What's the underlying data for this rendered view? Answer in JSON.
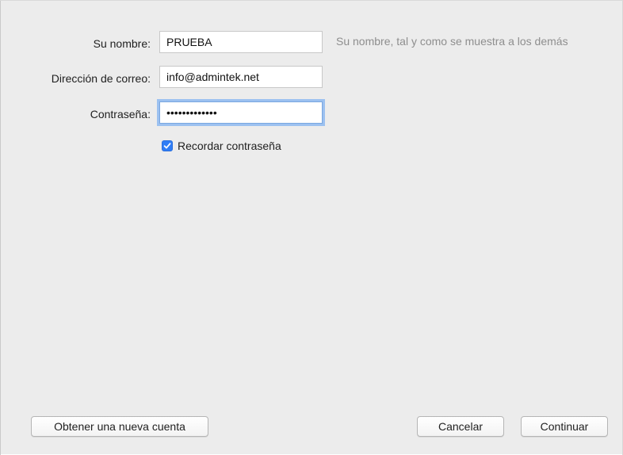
{
  "form": {
    "name_label": "Su nombre:",
    "name_value": "PRUEBA",
    "name_hint": "Su nombre, tal y como se muestra a los demás",
    "email_label": "Dirección de correo:",
    "email_value": "info@admintek.net",
    "password_label": "Contraseña:",
    "password_value": "•••••••••••••",
    "remember_label": "Recordar contraseña",
    "remember_checked": true
  },
  "buttons": {
    "new_account": "Obtener una nueva cuenta",
    "cancel": "Cancelar",
    "continue": "Continuar"
  },
  "colors": {
    "checkbox_accent": "#2f7df6",
    "focus_ring": "#9cc1f0"
  }
}
